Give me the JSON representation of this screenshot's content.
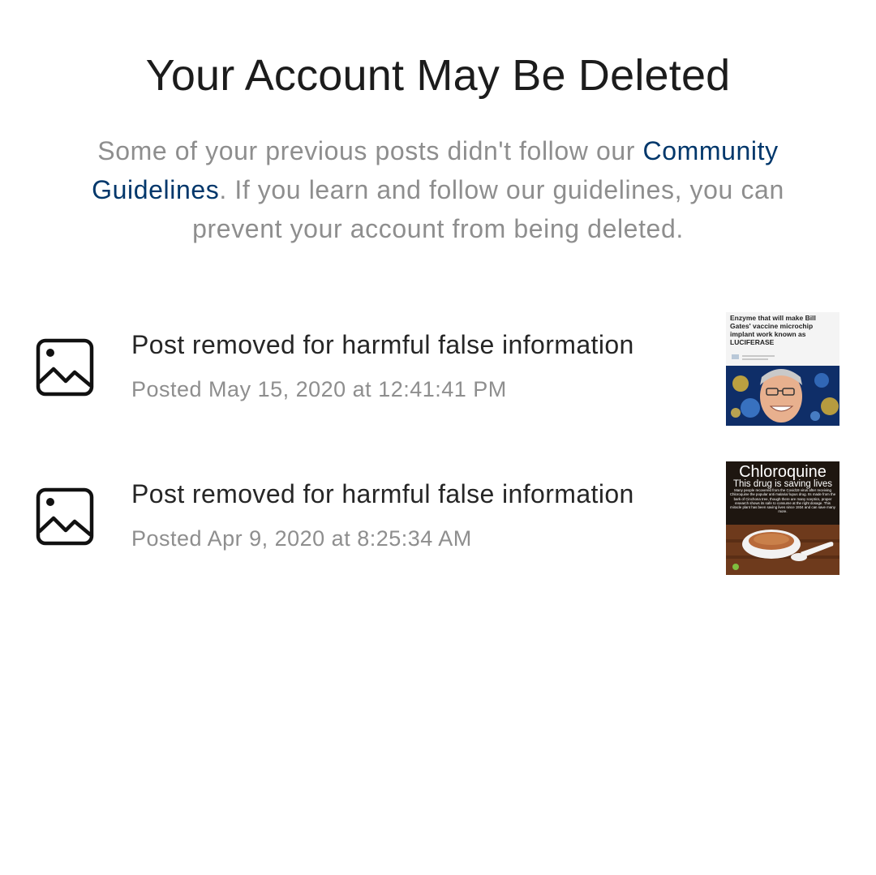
{
  "header": {
    "title": "Your Account May Be Deleted"
  },
  "notice": {
    "text_before": "Some of your previous posts didn't follow our ",
    "link_label": "Community Guidelines",
    "text_after": ". If you learn and follow our guidelines, you can prevent your account from being deleted."
  },
  "posts": [
    {
      "title": "Post removed for harmful false information",
      "posted": "Posted May 15, 2020 at 12:41:41 PM",
      "icon": "image-icon",
      "thumbnail": {
        "headline": "Enzyme that will make Bill Gates' vaccine microchip implant work known as LUCIFERASE"
      }
    },
    {
      "title": "Post removed for harmful false information",
      "posted": "Posted Apr 9, 2020 at 8:25:34 AM",
      "icon": "image-icon",
      "thumbnail": {
        "headline": "Chloroquine",
        "subhead": "This drug is saving lives",
        "body": "Many people recovered from the Covid19 virus after receiving Chloroquine the popular anti malaria/ lupus drug. Its made from the bark of Cinchona tree, though there are many sceptics, proper research shows its safe to consume at the right dosage. This miracle plant has been saving lives since 1934 and can save many more."
      }
    }
  ],
  "colors": {
    "title": "#1c1c1c",
    "text": "#262626",
    "secondary": "#8e8e8e",
    "link": "#00376b"
  }
}
